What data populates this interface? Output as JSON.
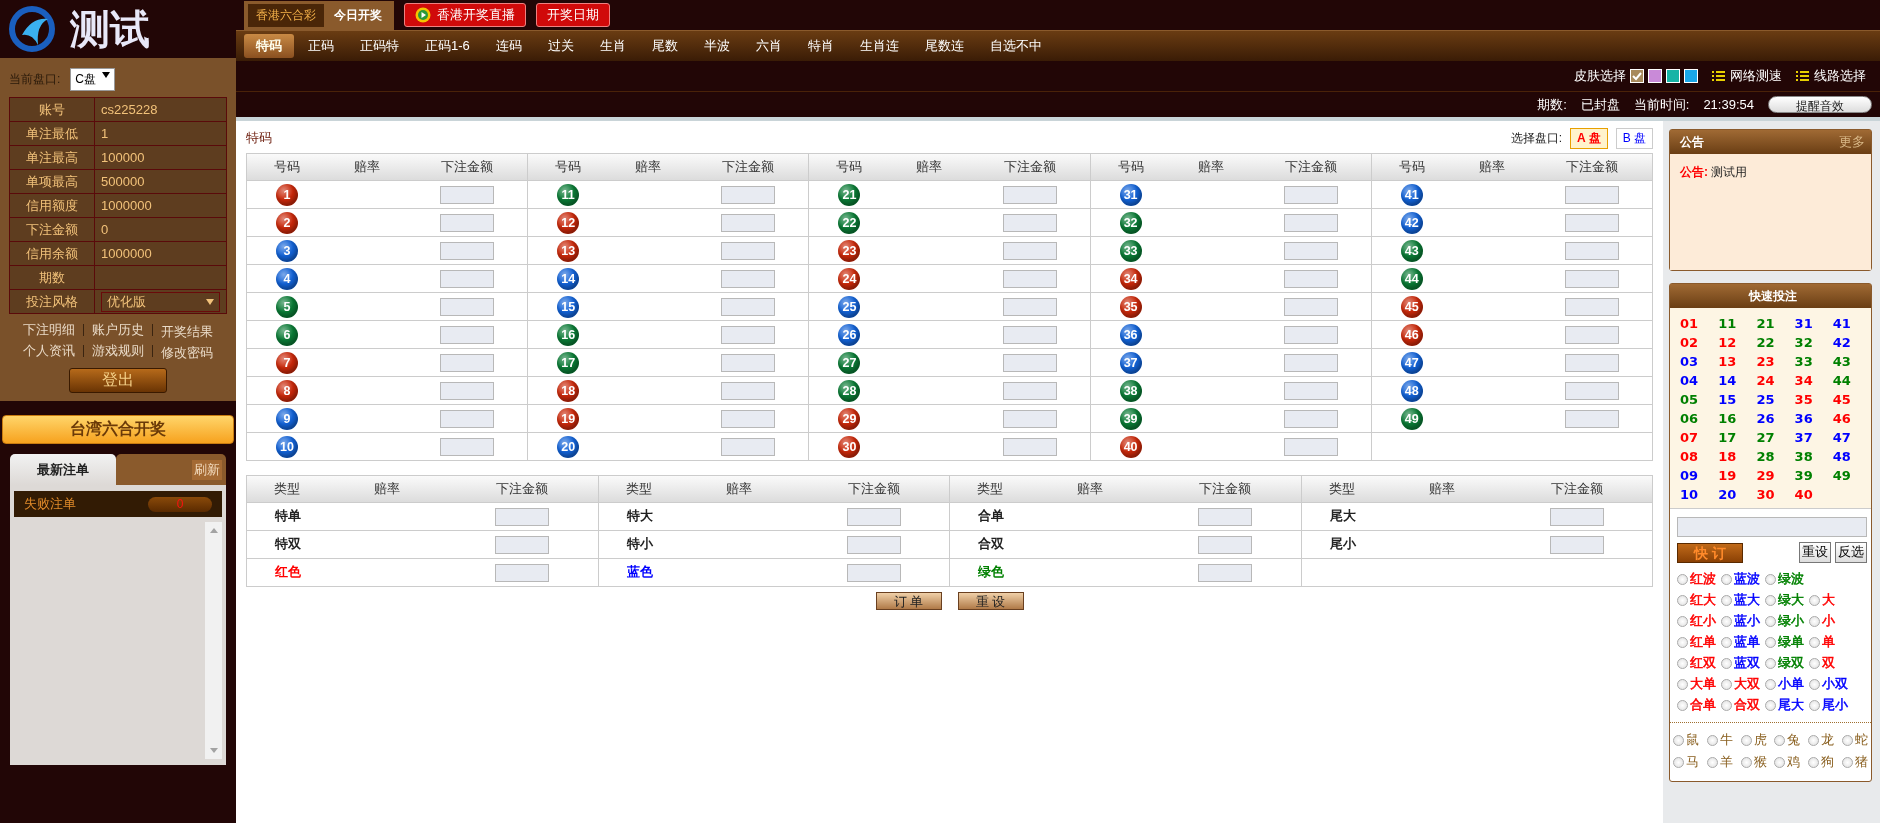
{
  "logo": {
    "title": "测试"
  },
  "sidebar": {
    "market_label": "当前盘口:",
    "market_value": "C盘",
    "info": [
      {
        "label": "账号",
        "value": "cs225228"
      },
      {
        "label": "单注最低",
        "value": "1"
      },
      {
        "label": "单注最高",
        "value": "100000"
      },
      {
        "label": "单项最高",
        "value": "500000"
      },
      {
        "label": "信用额度",
        "value": "1000000"
      },
      {
        "label": "下注金额",
        "value": "0"
      },
      {
        "label": "信用余额",
        "value": "1000000"
      },
      {
        "label": "期数"
      }
    ],
    "style": {
      "label": "投注风格",
      "value": "优化版"
    },
    "links": [
      "下注明细",
      "账户历史",
      "开奖结果",
      "个人资讯",
      "游戏规则",
      "修改密码"
    ],
    "logout": "登出",
    "draw_banner": "台湾六合开奖",
    "tabs": [
      {
        "label": "最新注单",
        "selected": true
      }
    ],
    "refresh": "刷新",
    "failed": {
      "label": "失败注单",
      "count": "0"
    }
  },
  "top": {
    "lottery_tabs": [
      {
        "label": "香港六合彩",
        "selected": true
      },
      {
        "label": "今日开奖",
        "selected": false
      }
    ],
    "live_button": "香港开奖直播",
    "date_button": "开奖日期"
  },
  "nav": [
    {
      "label": "特码",
      "selected": true
    },
    {
      "label": "正码",
      "selected": false
    },
    {
      "label": "正码特",
      "selected": false
    },
    {
      "label": "正码1-6",
      "selected": false
    },
    {
      "label": "连码",
      "selected": false
    },
    {
      "label": "过关",
      "selected": false
    },
    {
      "label": "生肖",
      "selected": false
    },
    {
      "label": "尾数",
      "selected": false
    },
    {
      "label": "半波",
      "selected": false
    },
    {
      "label": "六肖",
      "selected": false
    },
    {
      "label": "特肖",
      "selected": false
    },
    {
      "label": "生肖连",
      "selected": false
    },
    {
      "label": "尾数连",
      "selected": false
    },
    {
      "label": "自选不中",
      "selected": false
    }
  ],
  "skin": {
    "label": "皮肤选择",
    "swatches": [
      {
        "color": "#a88a5c",
        "selected": true
      },
      {
        "color": "#c98ad8",
        "selected": false
      },
      {
        "color": "#17b4a6",
        "selected": false
      },
      {
        "color": "#1aa7e8",
        "selected": false
      }
    ],
    "links": [
      "网络测速",
      "线路选择"
    ]
  },
  "status": {
    "period_label": "期数:",
    "state": "已封盘",
    "time_label": "当前时间:",
    "time": "21:39:54",
    "sound_button": "提醒音效"
  },
  "main": {
    "title": "特码",
    "market_label": "选择盘口:",
    "markets": [
      {
        "label": "A 盘",
        "selected": true
      },
      {
        "label": "B 盘",
        "selected": false
      }
    ],
    "groups": [
      {
        "headers": [
          "号码",
          "赔率",
          "下注金额"
        ],
        "balls": [
          {
            "number": "1",
            "color": "#c8280a"
          },
          {
            "number": "2",
            "color": "#c8280a"
          },
          {
            "number": "3",
            "color": "#1262d6"
          },
          {
            "number": "4",
            "color": "#1262d6"
          },
          {
            "number": "5",
            "color": "#0a7a35"
          },
          {
            "number": "6",
            "color": "#0a7a35"
          },
          {
            "number": "7",
            "color": "#c8280a"
          },
          {
            "number": "8",
            "color": "#c8280a"
          },
          {
            "number": "9",
            "color": "#1262d6"
          },
          {
            "number": "10",
            "color": "#1262d6"
          }
        ]
      },
      {
        "headers": [
          "号码",
          "赔率",
          "下注金额"
        ],
        "balls": [
          {
            "number": "11",
            "color": "#0a7a35"
          },
          {
            "number": "12",
            "color": "#c8280a"
          },
          {
            "number": "13",
            "color": "#c8280a"
          },
          {
            "number": "14",
            "color": "#1262d6"
          },
          {
            "number": "15",
            "color": "#1262d6"
          },
          {
            "number": "16",
            "color": "#0a7a35"
          },
          {
            "number": "17",
            "color": "#0a7a35"
          },
          {
            "number": "18",
            "color": "#c8280a"
          },
          {
            "number": "19",
            "color": "#c8280a"
          },
          {
            "number": "20",
            "color": "#1262d6"
          }
        ]
      },
      {
        "headers": [
          "号码",
          "赔率",
          "下注金额"
        ],
        "balls": [
          {
            "number": "21",
            "color": "#0a7a35"
          },
          {
            "number": "22",
            "color": "#0a7a35"
          },
          {
            "number": "23",
            "color": "#c8280a"
          },
          {
            "number": "24",
            "color": "#c8280a"
          },
          {
            "number": "25",
            "color": "#1262d6"
          },
          {
            "number": "26",
            "color": "#1262d6"
          },
          {
            "number": "27",
            "color": "#0a7a35"
          },
          {
            "number": "28",
            "color": "#0a7a35"
          },
          {
            "number": "29",
            "color": "#c8280a"
          },
          {
            "number": "30",
            "color": "#c8280a"
          }
        ]
      },
      {
        "headers": [
          "号码",
          "赔率",
          "下注金额"
        ],
        "balls": [
          {
            "number": "31",
            "color": "#1262d6"
          },
          {
            "number": "32",
            "color": "#0a7a35"
          },
          {
            "number": "33",
            "color": "#0a7a35"
          },
          {
            "number": "34",
            "color": "#c8280a"
          },
          {
            "number": "35",
            "color": "#c8280a"
          },
          {
            "number": "36",
            "color": "#1262d6"
          },
          {
            "number": "37",
            "color": "#1262d6"
          },
          {
            "number": "38",
            "color": "#0a7a35"
          },
          {
            "number": "39",
            "color": "#0a7a35"
          },
          {
            "number": "40",
            "color": "#c8280a"
          }
        ]
      },
      {
        "headers": [
          "号码",
          "赔率",
          "下注金额"
        ],
        "balls": [
          {
            "number": "41",
            "color": "#1262d6"
          },
          {
            "number": "42",
            "color": "#1262d6"
          },
          {
            "number": "43",
            "color": "#0a7a35"
          },
          {
            "number": "44",
            "color": "#0a7a35"
          },
          {
            "number": "45",
            "color": "#c8280a"
          },
          {
            "number": "46",
            "color": "#c8280a"
          },
          {
            "number": "47",
            "color": "#1262d6"
          },
          {
            "number": "48",
            "color": "#1262d6"
          },
          {
            "number": "49",
            "color": "#0a7a35"
          }
        ]
      }
    ],
    "extra_groups": [
      {
        "headers": [
          "类型",
          "赔率",
          "下注金额"
        ],
        "items": [
          {
            "label": "特单",
            "color": "#222222"
          },
          {
            "label": "特双",
            "color": "#222222"
          },
          {
            "label": "红色",
            "color": "#ff0000"
          }
        ]
      },
      {
        "headers": [
          "类型",
          "赔率",
          "下注金额"
        ],
        "items": [
          {
            "label": "特大",
            "color": "#222222"
          },
          {
            "label": "特小",
            "color": "#222222"
          },
          {
            "label": "蓝色",
            "color": "#0000ff"
          }
        ]
      },
      {
        "headers": [
          "类型",
          "赔率",
          "下注金额"
        ],
        "items": [
          {
            "label": "合单",
            "color": "#222222"
          },
          {
            "label": "合双",
            "color": "#222222"
          },
          {
            "label": "绿色",
            "color": "#008000"
          }
        ]
      },
      {
        "headers": [
          "类型",
          "赔率",
          "下注金额"
        ],
        "items": [
          {
            "label": "尾大",
            "color": "#222222"
          },
          {
            "label": "尾小",
            "color": "#222222"
          }
        ]
      }
    ],
    "actions": [
      "订 单",
      "重 设"
    ]
  },
  "right": {
    "notice": {
      "title": "公告",
      "more": "更多",
      "label": "公告:",
      "text": "测试用"
    },
    "quick": {
      "title": "快速投注",
      "numbers": [
        {
          "label": "01",
          "color": "#ff0000"
        },
        {
          "label": "02",
          "color": "#ff0000"
        },
        {
          "label": "03",
          "color": "#0000ff"
        },
        {
          "label": "04",
          "color": "#0000ff"
        },
        {
          "label": "05",
          "color": "#008000"
        },
        {
          "label": "06",
          "color": "#008000"
        },
        {
          "label": "07",
          "color": "#ff0000"
        },
        {
          "label": "08",
          "color": "#ff0000"
        },
        {
          "label": "09",
          "color": "#0000ff"
        },
        {
          "label": "10",
          "color": "#0000ff"
        },
        {
          "label": "11",
          "color": "#008000"
        },
        {
          "label": "12",
          "color": "#ff0000"
        },
        {
          "label": "13",
          "color": "#ff0000"
        },
        {
          "label": "14",
          "color": "#0000ff"
        },
        {
          "label": "15",
          "color": "#0000ff"
        },
        {
          "label": "16",
          "color": "#008000"
        },
        {
          "label": "17",
          "color": "#008000"
        },
        {
          "label": "18",
          "color": "#ff0000"
        },
        {
          "label": "19",
          "color": "#ff0000"
        },
        {
          "label": "20",
          "color": "#0000ff"
        },
        {
          "label": "21",
          "color": "#008000"
        },
        {
          "label": "22",
          "color": "#008000"
        },
        {
          "label": "23",
          "color": "#ff0000"
        },
        {
          "label": "24",
          "color": "#ff0000"
        },
        {
          "label": "25",
          "color": "#0000ff"
        },
        {
          "label": "26",
          "color": "#0000ff"
        },
        {
          "label": "27",
          "color": "#008000"
        },
        {
          "label": "28",
          "color": "#008000"
        },
        {
          "label": "29",
          "color": "#ff0000"
        },
        {
          "label": "30",
          "color": "#ff0000"
        },
        {
          "label": "31",
          "color": "#0000ff"
        },
        {
          "label": "32",
          "color": "#008000"
        },
        {
          "label": "33",
          "color": "#008000"
        },
        {
          "label": "34",
          "color": "#ff0000"
        },
        {
          "label": "35",
          "color": "#ff0000"
        },
        {
          "label": "36",
          "color": "#0000ff"
        },
        {
          "label": "37",
          "color": "#0000ff"
        },
        {
          "label": "38",
          "color": "#008000"
        },
        {
          "label": "39",
          "color": "#008000"
        },
        {
          "label": "40",
          "color": "#ff0000"
        },
        {
          "label": "41",
          "color": "#0000ff"
        },
        {
          "label": "42",
          "color": "#0000ff"
        },
        {
          "label": "43",
          "color": "#008000"
        },
        {
          "label": "44",
          "color": "#008000"
        },
        {
          "label": "45",
          "color": "#ff0000"
        },
        {
          "label": "46",
          "color": "#ff0000"
        },
        {
          "label": "47",
          "color": "#0000ff"
        },
        {
          "label": "48",
          "color": "#0000ff"
        },
        {
          "label": "49",
          "color": "#008000"
        }
      ],
      "submit": "快 订",
      "reset": "重设",
      "invert": "反选",
      "option_rows": [
        [
          {
            "label": "红波",
            "color": "#ff0000",
            "checked": false
          },
          {
            "label": "蓝波",
            "color": "#0000ff",
            "checked": false
          },
          {
            "label": "绿波",
            "color": "#008000",
            "checked": false
          }
        ],
        [
          {
            "label": "红大",
            "color": "#ff0000",
            "checked": false
          },
          {
            "label": "蓝大",
            "color": "#0000ff",
            "checked": false
          },
          {
            "label": "绿大",
            "color": "#008000",
            "checked": false
          },
          {
            "label": "大",
            "color": "#ff0000",
            "checked": false
          }
        ],
        [
          {
            "label": "红小",
            "color": "#ff0000",
            "checked": false
          },
          {
            "label": "蓝小",
            "color": "#0000ff",
            "checked": false
          },
          {
            "label": "绿小",
            "color": "#008000",
            "checked": false
          },
          {
            "label": "小",
            "color": "#ff0000",
            "checked": false
          }
        ],
        [
          {
            "label": "红单",
            "color": "#ff0000",
            "checked": false
          },
          {
            "label": "蓝单",
            "color": "#0000ff",
            "checked": false
          },
          {
            "label": "绿单",
            "color": "#008000",
            "checked": false
          },
          {
            "label": "单",
            "color": "#ff0000",
            "checked": false
          }
        ],
        [
          {
            "label": "红双",
            "color": "#ff0000",
            "checked": false
          },
          {
            "label": "蓝双",
            "color": "#0000ff",
            "checked": false
          },
          {
            "label": "绿双",
            "color": "#008000",
            "checked": false
          },
          {
            "label": "双",
            "color": "#ff0000",
            "checked": false
          }
        ],
        [
          {
            "label": "大单",
            "color": "#ff0000",
            "checked": false
          },
          {
            "label": "大双",
            "color": "#ff0000",
            "checked": false
          },
          {
            "label": "小单",
            "color": "#0000ff",
            "checked": false
          },
          {
            "label": "小双",
            "color": "#0000ff",
            "checked": false
          }
        ],
        [
          {
            "label": "合单",
            "color": "#ff0000",
            "checked": false
          },
          {
            "label": "合双",
            "color": "#ff0000",
            "checked": false
          },
          {
            "label": "尾大",
            "color": "#0000ff",
            "checked": false
          },
          {
            "label": "尾小",
            "color": "#0000ff",
            "checked": false
          }
        ]
      ],
      "zodiac": [
        {
          "label": "鼠",
          "checked": false
        },
        {
          "label": "牛",
          "checked": false
        },
        {
          "label": "虎",
          "checked": false
        },
        {
          "label": "兔",
          "checked": false
        },
        {
          "label": "龙",
          "checked": false
        },
        {
          "label": "蛇",
          "checked": false
        },
        {
          "label": "马",
          "checked": false
        },
        {
          "label": "羊",
          "checked": false
        },
        {
          "label": "猴",
          "checked": false
        },
        {
          "label": "鸡",
          "checked": false
        },
        {
          "label": "狗",
          "checked": false
        },
        {
          "label": "猪",
          "checked": false
        }
      ]
    }
  }
}
